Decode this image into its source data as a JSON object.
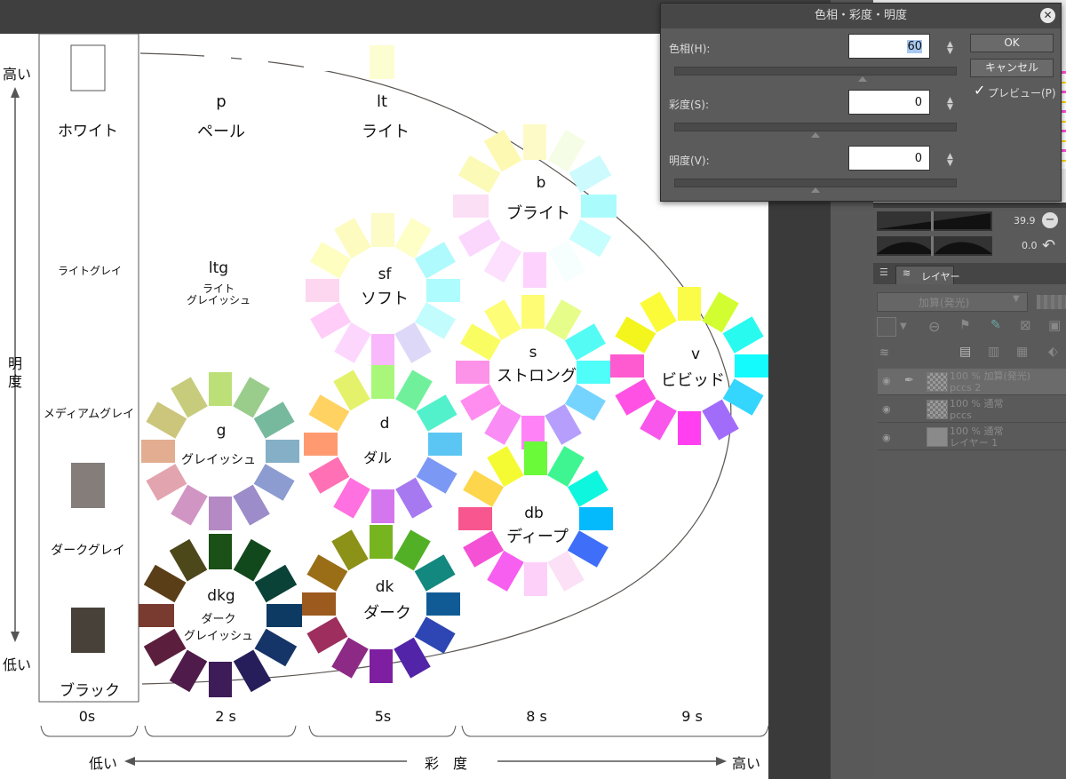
{
  "canvas": {
    "brightness_high": "高い",
    "brightness_axis": [
      "明",
      "度"
    ],
    "brightness_low": "低い",
    "grays": {
      "white": "ホワイト",
      "light_gray": "ライトグレイ",
      "medium_gray": "メディアムグレイ",
      "dark_gray": "ダークグレイ",
      "black": "ブラック"
    },
    "tones": {
      "p_code": "p",
      "p_name": "ペール",
      "lt_code": "lt",
      "lt_name": "ライト",
      "ltg_code": "ltg",
      "ltg_name1": "ライト",
      "ltg_name2": "グレイッシュ",
      "b_code": "b",
      "b_name": "ブライト",
      "sf_code": "sf",
      "sf_name": "ソフト",
      "s_code": "s",
      "s_name": "ストロング",
      "v_code": "v",
      "v_name": "ビビッド",
      "g_code": "g",
      "g_name": "グレイッシュ",
      "d_code": "d",
      "d_name": "ダル",
      "db_code": "db",
      "db_name": "ディープ",
      "dkg_code": "dkg",
      "dkg_name1": "ダーク",
      "dkg_name2": "グレイッシュ",
      "dk_code": "dk",
      "dk_name": "ダーク"
    },
    "saturation_ticks": [
      "0s",
      "2 s",
      "5s",
      "8 s",
      "9 s"
    ],
    "saturation_low": "低い",
    "saturation_axis": "彩　度",
    "saturation_high": "高い"
  },
  "dialog": {
    "title": "色相・彩度・明度",
    "hue_label": "色相(H):",
    "hue_value": "60",
    "saturation_label": "彩度(S):",
    "saturation_value": "0",
    "value_label": "明度(V):",
    "value_value": "0",
    "ok_label": "OK",
    "cancel_label": "キャンセル",
    "preview_label": "プレビュー(P)",
    "preview_checked": true
  },
  "panel": {
    "brush_size_value": "39.9",
    "angle_value": "0.0",
    "layer_tab": "レイヤー",
    "blend_mode": "加算(発光)",
    "layers": [
      {
        "line1": "100 % 加算(発光)",
        "line2": "pccs 2"
      },
      {
        "line1": "100 % 通常",
        "line2": "pccs"
      },
      {
        "line1": "100 % 通常",
        "line2": "レイヤー 1"
      }
    ]
  },
  "colors": {
    "canvas_bg": "#ffffff",
    "panel_bg": "#5a5a5a",
    "dialog_bg": "#5b5b5b",
    "arc_line": "#5a5550"
  }
}
